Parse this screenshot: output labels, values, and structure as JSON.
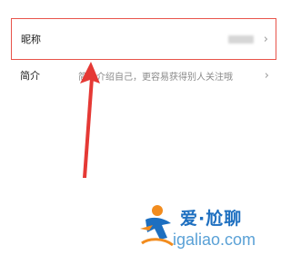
{
  "profile": {
    "nickname": {
      "label": "昵称",
      "value": ""
    },
    "intro": {
      "label": "简介",
      "placeholder": "简单介绍自己，更容易获得别人关注哦"
    }
  },
  "chevron": "›",
  "watermark": {
    "name": "爱·尬聊",
    "url": "igaliao.com"
  },
  "colors": {
    "highlight": "#e8534a",
    "arrow": "#e53935",
    "brand_blue": "#1d6fc0",
    "brand_orange": "#f28c1e"
  },
  "icons": [
    "chevron-right-icon",
    "red-arrow-annotation",
    "watermark-logo-figure"
  ]
}
